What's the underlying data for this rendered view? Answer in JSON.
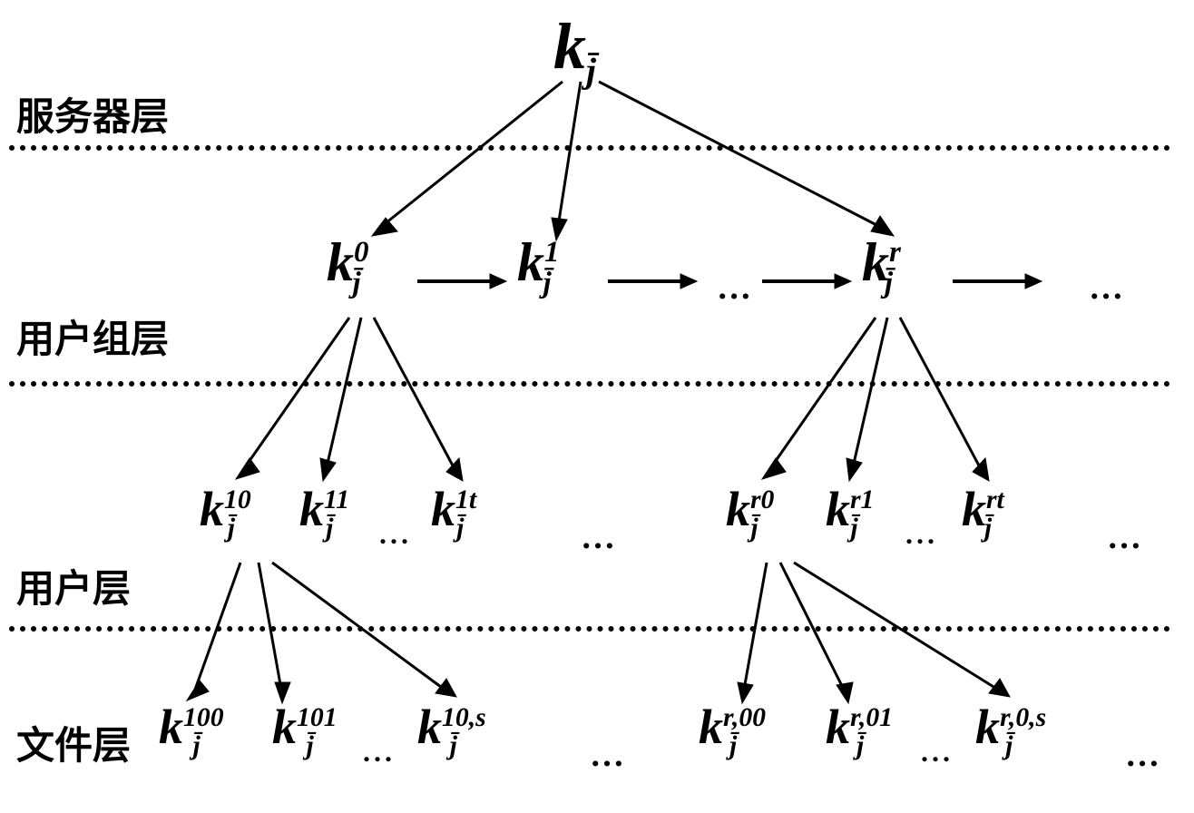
{
  "layers": {
    "server": "服务器层",
    "usergroup": "用户组层",
    "user": "用户层",
    "file": "文件层"
  },
  "nodes": {
    "root": {
      "base": "k",
      "sub": "j̄"
    },
    "g0": {
      "base": "k",
      "sub": "j̄",
      "sup": "0"
    },
    "g1": {
      "base": "k",
      "sub": "j̄",
      "sup": "1"
    },
    "gr": {
      "base": "k",
      "sub": "j̄",
      "sup": "r"
    },
    "u10": {
      "base": "k",
      "sub": "j̄",
      "sup": "10"
    },
    "u11": {
      "base": "k",
      "sub": "j̄",
      "sup": "11"
    },
    "u1t": {
      "base": "k",
      "sub": "j̄",
      "sup": "1t"
    },
    "ur0": {
      "base": "k",
      "sub": "j̄",
      "sup": "r0"
    },
    "ur1": {
      "base": "k",
      "sub": "j̄",
      "sup": "r1"
    },
    "urt": {
      "base": "k",
      "sub": "j̄",
      "sup": "rt"
    },
    "f100": {
      "base": "k",
      "sub": "j̄",
      "sup": "100"
    },
    "f101": {
      "base": "k",
      "sub": "j̄",
      "sup": "101"
    },
    "f10s": {
      "base": "k",
      "sub": "j̄",
      "sup": "10,s"
    },
    "fr00": {
      "base": "k",
      "sub": "j̄",
      "sup": "r,00"
    },
    "fr01": {
      "base": "k",
      "sub": "j̄",
      "sup": "r,01"
    },
    "fr0s": {
      "base": "k",
      "sub": "j̄",
      "sup": "r,0,s"
    }
  },
  "ellipsis": "…",
  "ellipsis3": "..."
}
